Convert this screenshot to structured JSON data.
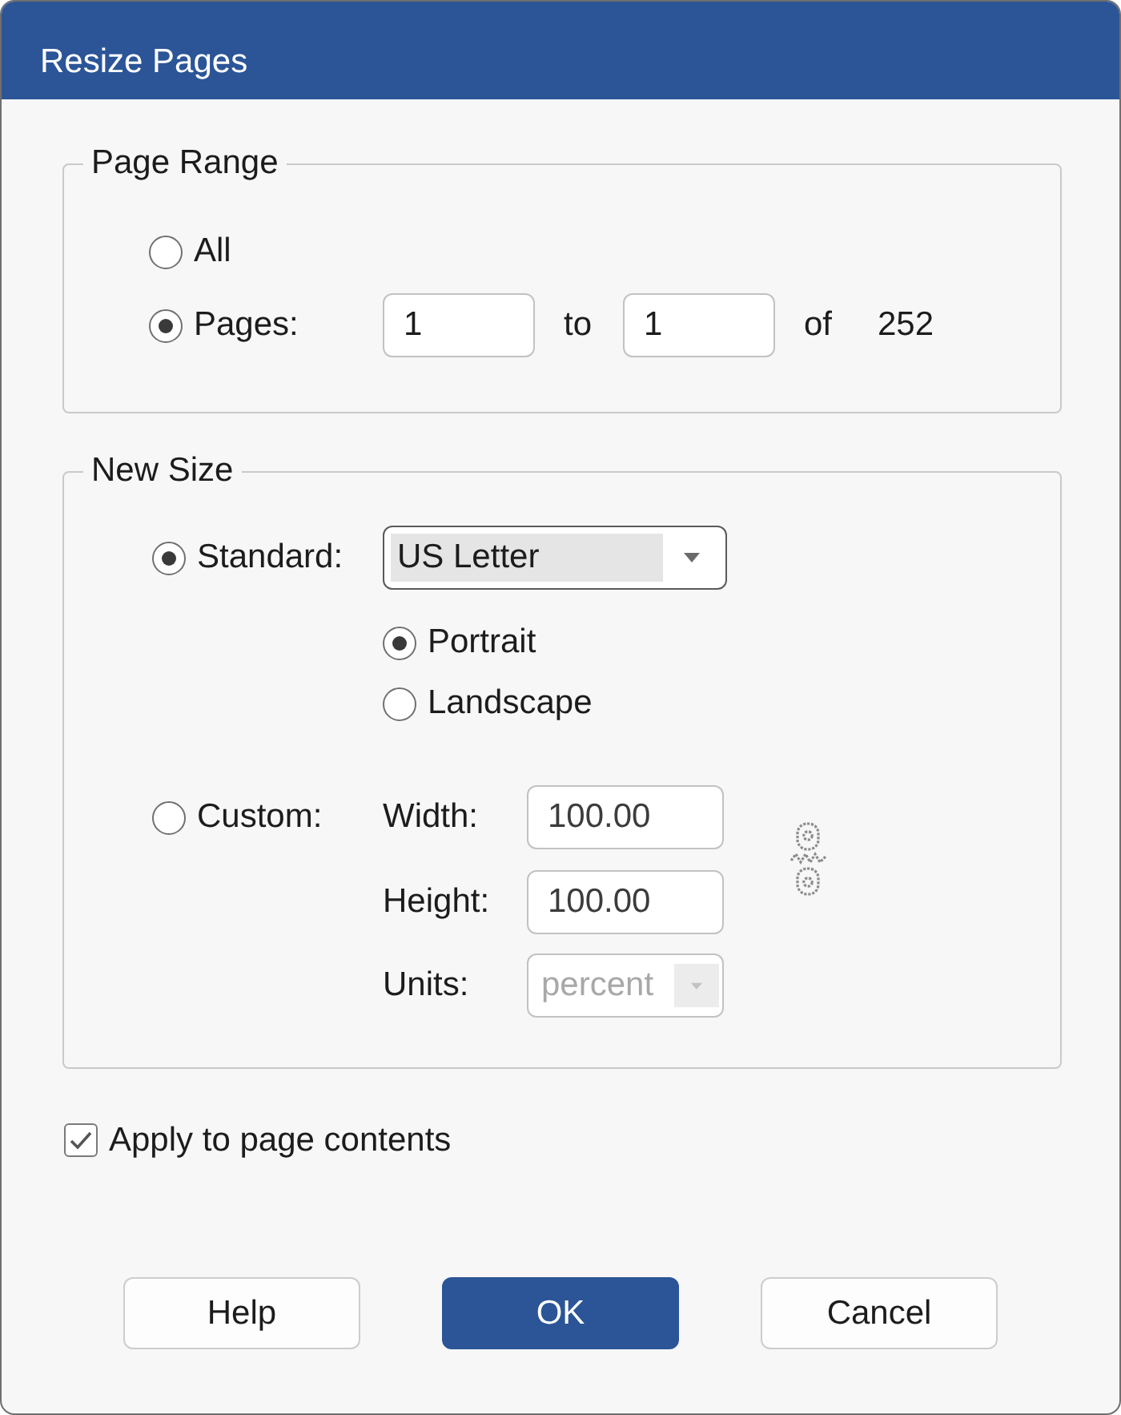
{
  "window": {
    "title": "Resize Pages"
  },
  "page_range": {
    "legend": "Page Range",
    "options": [
      {
        "kind": "all",
        "label": "All",
        "selected": false
      },
      {
        "kind": "range",
        "label": "Pages:",
        "selected": true
      }
    ],
    "range": {
      "from": "1",
      "to_label": "to",
      "to": "1",
      "of_label": "of",
      "total": "252"
    }
  },
  "new_size": {
    "legend": "New Size",
    "modes": [
      {
        "kind": "standard",
        "label": "Standard:",
        "selected": true
      },
      {
        "kind": "custom",
        "label": "Custom:",
        "selected": false
      }
    ],
    "paper": {
      "value": "US Letter",
      "highlighted": true
    },
    "orientations": [
      {
        "label": "Portrait",
        "selected": true
      },
      {
        "label": "Landscape",
        "selected": false
      }
    ],
    "fields": [
      {
        "kind": "input",
        "label": "Width:",
        "value": "100.00",
        "disabled": false
      },
      {
        "kind": "input",
        "label": "Height:",
        "value": "100.00",
        "disabled": false
      },
      {
        "kind": "dropdown",
        "label": "Units:",
        "value": "percent",
        "disabled": true
      }
    ]
  },
  "apply_contents": {
    "label": "Apply to page contents",
    "checked": true
  },
  "buttons": [
    {
      "label": "Help",
      "primary": false
    },
    {
      "label": "OK",
      "primary": true
    },
    {
      "label": "Cancel",
      "primary": false
    }
  ]
}
